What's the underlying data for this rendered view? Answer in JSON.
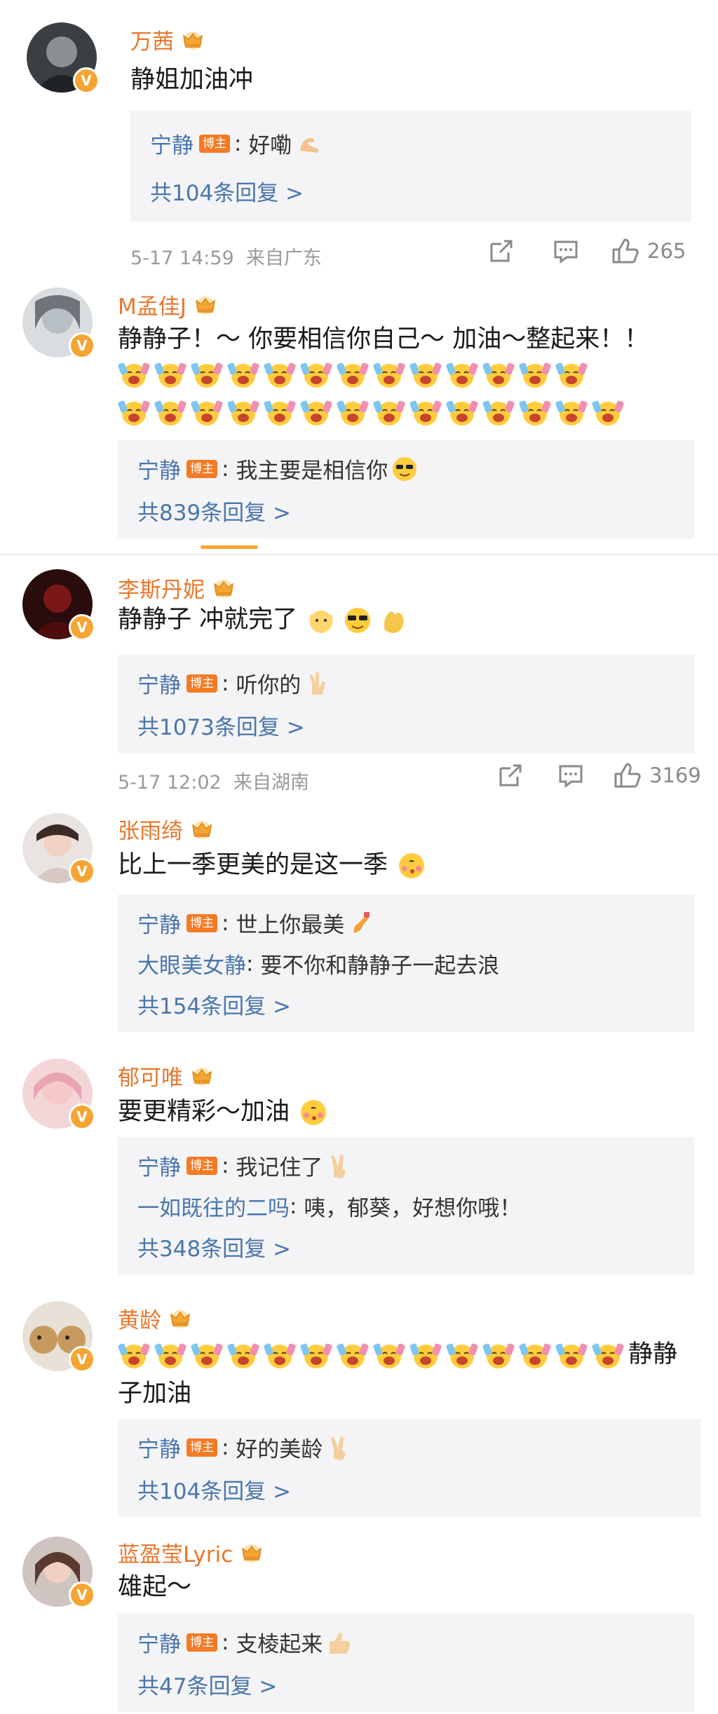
{
  "comments": [
    {
      "name": "万茜",
      "text": "静姐加油冲",
      "replies": [
        {
          "author": "宁静",
          "badge": "博主",
          "text": "好嘞",
          "emoji": "muscle-icon"
        }
      ],
      "reply_count": "共104条回复 >",
      "time": "5-17 14:59",
      "location": "来自广东",
      "likes": "265"
    },
    {
      "name": "M孟佳J",
      "text": "静静子！～ 你要相信你自己～ 加油～整起来！！",
      "emoji_rows": [
        13,
        14
      ],
      "replies": [
        {
          "author": "宁静",
          "badge": "博主",
          "text": "我主要是相信你",
          "emoji": "sunglasses-icon"
        }
      ],
      "reply_count": "共839条回复 >"
    },
    {
      "name": "李斯丹妮",
      "text": "静静子 冲就完了",
      "replies": [
        {
          "author": "宁静",
          "badge": "博主",
          "text": "听你的",
          "emoji": "rock-hand-icon"
        }
      ],
      "reply_count": "共1073条回复 >",
      "time": "5-17 12:02",
      "location": "来自湖南",
      "likes": "3169"
    },
    {
      "name": "张雨绮",
      "text": "比上一季更美的是这一季",
      "replies": [
        {
          "author": "宁静",
          "badge": "博主",
          "text": "世上你最美",
          "emoji": "nail-polish-icon"
        },
        {
          "author": "大眼美女静",
          "badge": "",
          "text": "要不你和静静子一起去浪",
          "emoji": ""
        }
      ],
      "reply_count": "共154条回复 >"
    },
    {
      "name": "郁可唯",
      "text": "要更精彩～加油",
      "replies": [
        {
          "author": "宁静",
          "badge": "博主",
          "text": "我记住了",
          "emoji": "victory-icon"
        },
        {
          "author": "一如既往的二吗",
          "badge": "",
          "text": "咦，郁葵，好想你哦！",
          "emoji": ""
        }
      ],
      "reply_count": "共348条回复 >"
    },
    {
      "name": "黄龄",
      "text": "静静",
      "text2": "子加油",
      "emoji_count": 14,
      "replies": [
        {
          "author": "宁静",
          "badge": "博主",
          "text": "好的美龄",
          "emoji": "victory-icon"
        }
      ],
      "reply_count": "共104条回复 >"
    },
    {
      "name": "蓝盈莹Lyric",
      "text": "雄起～",
      "replies": [
        {
          "author": "宁静",
          "badge": "博主",
          "text": "支棱起来",
          "emoji": "thumbs-up-icon"
        }
      ],
      "reply_count": "共47条回复 >"
    }
  ],
  "colors": {
    "name": "#e8772c",
    "link": "#4a76ac",
    "badge": "#f57a24",
    "reply_bg": "#f4f4f6",
    "crown": "#f4a533"
  }
}
